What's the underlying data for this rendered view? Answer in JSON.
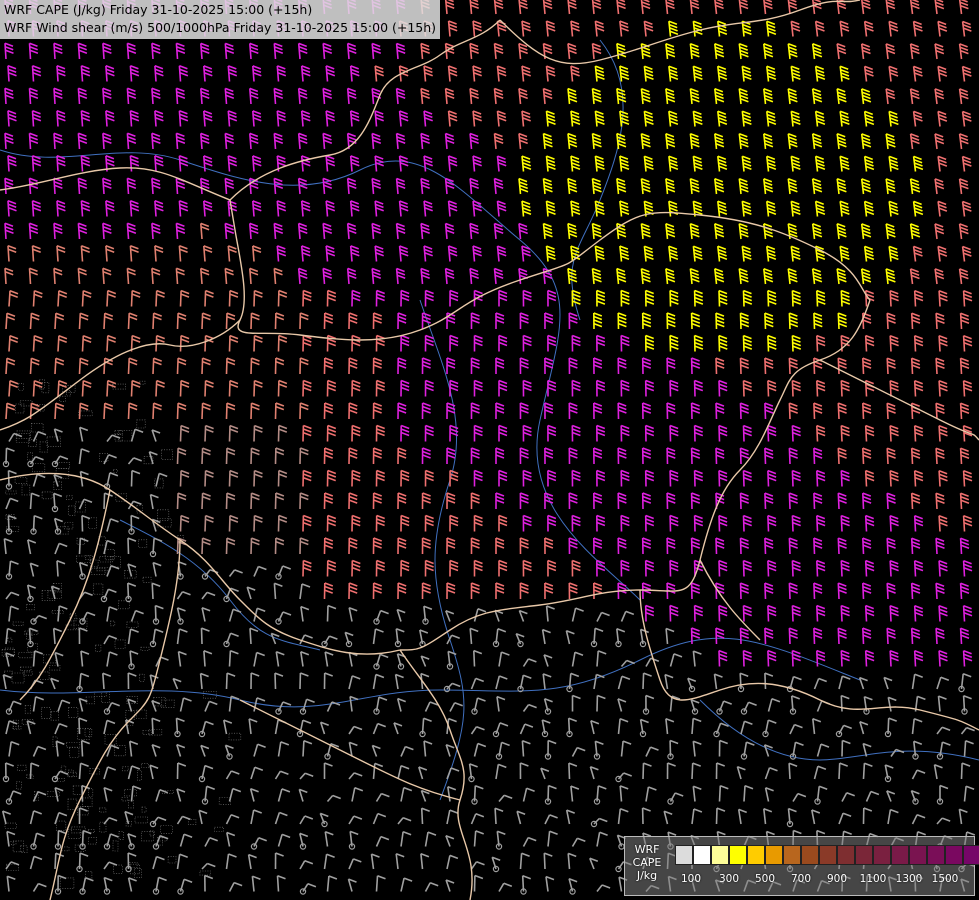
{
  "header": {
    "line1": "WRF CAPE (J/kg) Friday 31-10-2025 15:00 (+15h)",
    "line2": "WRF Wind shear (m/s) 500/1000hPa Friday 31-10-2025 15:00 (+15h)"
  },
  "legend": {
    "label_model": "WRF",
    "label_field": "CAPE",
    "label_unit": "J/kg",
    "swatch_colors": [
      "#dcdcdc",
      "#ffffff",
      "#ffff99",
      "#ffff00",
      "#ffcc00",
      "#e89a00",
      "#b8661e",
      "#9a4a1e",
      "#8a3a28",
      "#7e2e30",
      "#7a2638",
      "#7a2040",
      "#7a1a48",
      "#7a1450",
      "#7a0e58",
      "#7a0860",
      "#760668"
    ],
    "ticks": [
      "100",
      "300",
      "500",
      "700",
      "900",
      "1100",
      "1300",
      "1500"
    ]
  },
  "map_colors": {
    "shear_low": "#a0a0a0",
    "shear_mid_low": "#b48c86",
    "shear_mid": "#e08070",
    "shear_high": "#f07070",
    "shear_very_high": "#e020e0",
    "shear_extreme": "#ffff00",
    "borders": "#e8c8a8",
    "rivers": "#4070c0",
    "terrain": "#808080"
  }
}
